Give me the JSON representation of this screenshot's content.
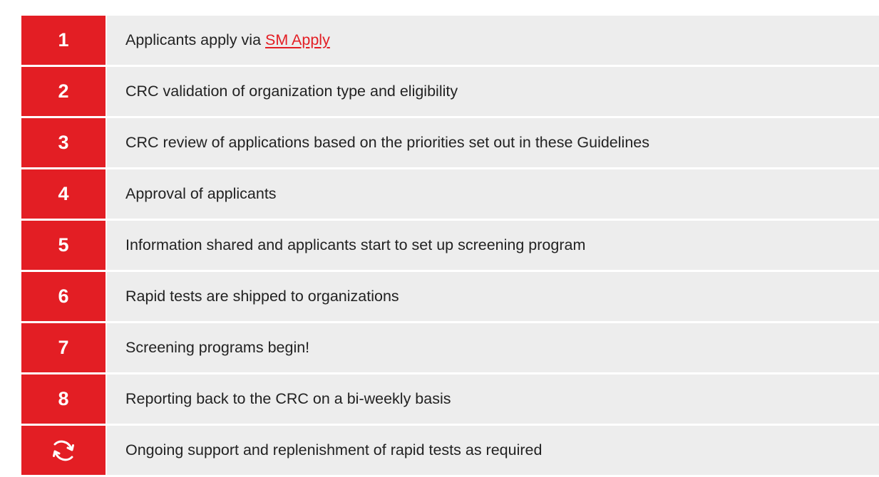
{
  "colors": {
    "accent": "#e31e24",
    "row_background": "#ededed",
    "text": "#222222"
  },
  "steps": [
    {
      "number": "1",
      "text": "Applicants apply via ",
      "link_text": "SM Apply"
    },
    {
      "number": "2",
      "text": "CRC validation of organization type and eligibility"
    },
    {
      "number": "3",
      "text": "CRC review of applications based on the priorities set out in these Guidelines"
    },
    {
      "number": "4",
      "text": "Approval of applicants"
    },
    {
      "number": "5",
      "text": "Information shared and applicants start to set up screening program"
    },
    {
      "number": "6",
      "text": "Rapid tests are shipped to organizations"
    },
    {
      "number": "7",
      "text": "Screening programs begin!"
    },
    {
      "number": "8",
      "text": "Reporting back to the CRC on a bi-weekly basis"
    },
    {
      "icon": "cycle-arrows-icon",
      "text": "Ongoing support and replenishment of rapid tests as required"
    }
  ]
}
